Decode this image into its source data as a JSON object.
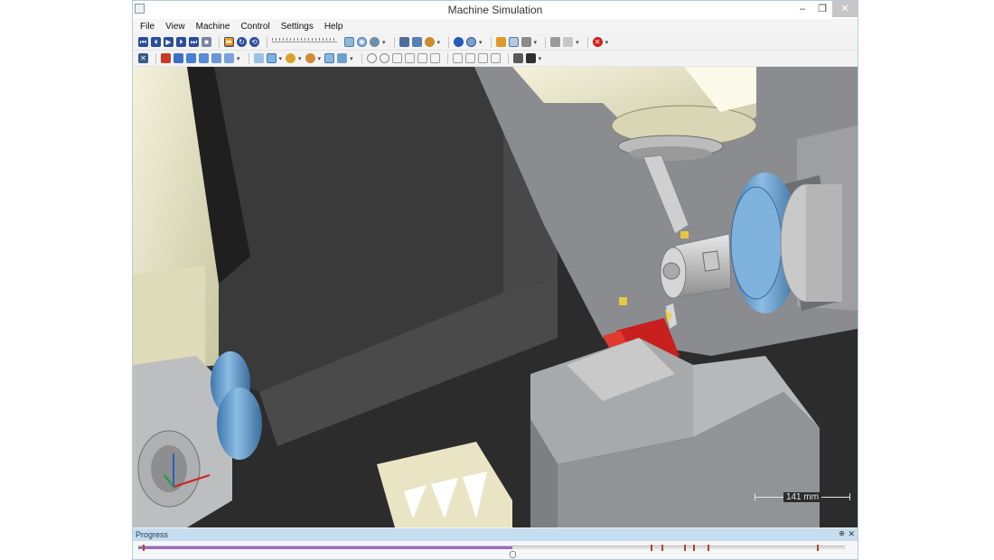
{
  "window": {
    "title": "Machine Simulation",
    "controls": [
      "–",
      "❐",
      "✕"
    ]
  },
  "menu": {
    "items": [
      "File",
      "View",
      "Machine",
      "Control",
      "Settings",
      "Help"
    ]
  },
  "toolbar1": {
    "groups": [
      {
        "name": "playback",
        "icons": [
          "rewind-to-start-icon",
          "step-back-icon",
          "play-icon",
          "step-forward-icon",
          "fast-forward-to-end-icon",
          "stop-icon"
        ]
      },
      {
        "name": "cycle",
        "icons": [
          "skip-icon",
          "loop-icon",
          "reset-icon"
        ]
      },
      {
        "name": "display",
        "icons": [
          "view-mode-icon",
          "shaded-sphere-icon",
          "gear-part-icon"
        ]
      },
      {
        "name": "camera",
        "icons": [
          "camera-icon",
          "ruler-icon",
          "measure-icon"
        ]
      },
      {
        "name": "stock",
        "icons": [
          "blue-sphere-icon",
          "stock-sphere-icon"
        ]
      },
      {
        "name": "tools",
        "icons": [
          "axis-icon",
          "grid-icon",
          "cube-icon"
        ]
      },
      {
        "name": "edit",
        "icons": [
          "pencil-icon",
          "line-icon"
        ]
      },
      {
        "name": "stop",
        "icons": [
          "error-stop-icon"
        ]
      }
    ],
    "speed_label": "Simulation speed"
  },
  "toolbar2": {
    "groups": [
      {
        "name": "fit",
        "icons": [
          "fit-view-icon"
        ]
      },
      {
        "name": "components",
        "icons": [
          "red-cube-icon",
          "blue-cube-icon",
          "blue-cube-icon",
          "blue-cube-icon",
          "blue-cube-icon",
          "blue-cube-icon"
        ]
      },
      {
        "name": "visibility",
        "icons": [
          "visibility-icon",
          "machine-visibility-icon",
          "tool-visibility-icon",
          "stock-visibility-icon",
          "fixture-visibility-icon",
          "workpiece-visibility-icon"
        ]
      },
      {
        "name": "rotation",
        "icons": [
          "rotate-left-icon",
          "rotate-right-icon",
          "pan-icon",
          "zoom-icon",
          "zoom-in-icon",
          "zoom-out-icon"
        ]
      },
      {
        "name": "views",
        "icons": [
          "iso-view-icon",
          "top-view-icon",
          "front-view-icon",
          "side-view-icon"
        ]
      },
      {
        "name": "render",
        "icons": [
          "wireframe-icon",
          "shaded-icon"
        ]
      }
    ]
  },
  "viewport": {
    "scale_text": "141 mm"
  },
  "progress": {
    "title": "Progress",
    "pin_glyph": "⊕",
    "close_glyph": "✕",
    "value": 0.53,
    "marker_positions": [
      0.007,
      0.725,
      0.74,
      0.772,
      0.785,
      0.805,
      0.96
    ]
  },
  "colors": {
    "accent_blue": "#6fa2cf",
    "tool_red": "#c8201e",
    "insert_yellow": "#e3c24a",
    "machine_cream": "#ece9c8",
    "housing_gray": "#8a8c8f",
    "background_dark": "#2c2c2c"
  }
}
